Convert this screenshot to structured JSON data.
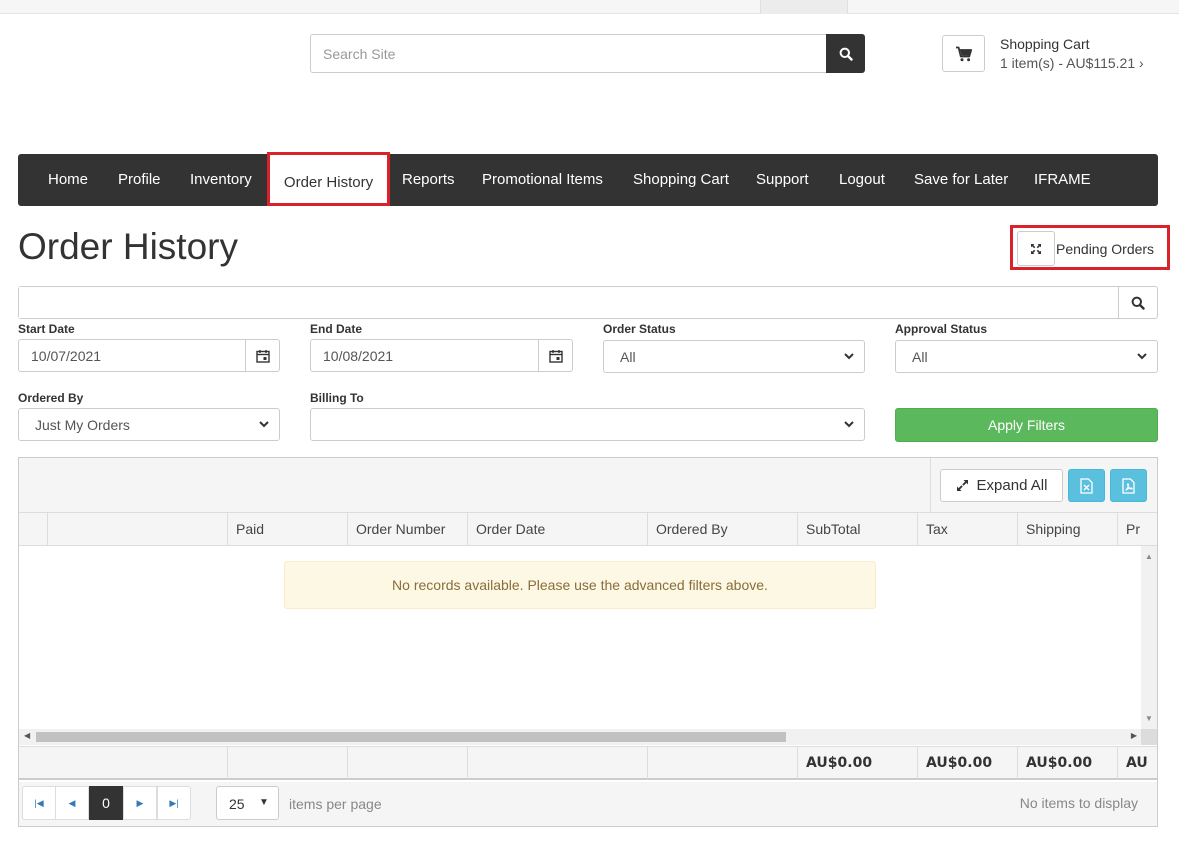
{
  "header": {
    "search_placeholder": "Search Site",
    "cart_title": "Shopping Cart",
    "cart_summary": "1 item(s) - AU$115.21 ›"
  },
  "nav": {
    "items": [
      "Home",
      "Profile",
      "Inventory",
      "Order History",
      "Reports",
      "Promotional Items",
      "Shopping Cart",
      "Support",
      "Logout",
      "Save for Later",
      "IFRAME"
    ],
    "active": "Order History"
  },
  "page": {
    "title": "Order History",
    "pending_label": "Pending Orders"
  },
  "filters": {
    "start_date_label": "Start Date",
    "start_date": "10/07/2021",
    "end_date_label": "End Date",
    "end_date": "10/08/2021",
    "order_status_label": "Order Status",
    "order_status": "All",
    "approval_status_label": "Approval Status",
    "approval_status": "All",
    "ordered_by_label": "Ordered By",
    "ordered_by": "Just My Orders",
    "billing_to_label": "Billing To",
    "billing_to": "",
    "apply_label": "Apply Filters"
  },
  "grid": {
    "expand_all": "Expand All",
    "columns": [
      "",
      "",
      "Paid",
      "Order Number",
      "Order Date",
      "Ordered By",
      "SubTotal",
      "Tax",
      "Shipping",
      "Pr"
    ],
    "no_records": "No records available. Please use the advanced filters above.",
    "footer": [
      "",
      "",
      "",
      "",
      "",
      "",
      "AU$0.00",
      "AU$0.00",
      "AU$0.00",
      "AU"
    ]
  },
  "pager": {
    "current_page": "0",
    "page_size": "25",
    "items_per_page": "items per page",
    "info": "No items to display"
  },
  "colors": {
    "navbar": "#333333",
    "highlight": "#d9222a",
    "apply": "#5cb85c",
    "export": "#5bc0de",
    "notice_bg": "#fcf8e3"
  }
}
